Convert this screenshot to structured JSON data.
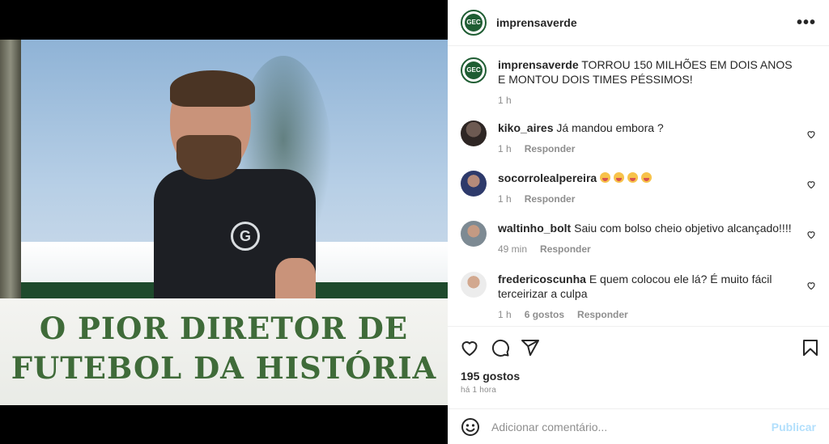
{
  "post": {
    "username": "imprensaverde",
    "more_label": "•••",
    "media": {
      "headline_line1": "O PIOR DIRETOR DE",
      "headline_line2": "FUTEBOL DA HISTÓRIA",
      "badge_letter": "G"
    },
    "caption": {
      "username": "imprensaverde",
      "text": "TORROU 150 MILHÕES EM DOIS ANOS E MONTOU DOIS TIMES PÉSSIMOS!",
      "time": "1 h"
    },
    "comments": [
      {
        "username": "kiko_aires",
        "text": "Já mandou embora ?",
        "time": "1 h",
        "likes": "",
        "reply_label": "Responder"
      },
      {
        "username": "socorrolealpereira",
        "text": "",
        "emoji_count": 4,
        "time": "1 h",
        "likes": "",
        "reply_label": "Responder"
      },
      {
        "username": "waltinho_bolt",
        "text": "Saiu com bolso cheio objetivo alcançado!!!!",
        "time": "49 min",
        "likes": "",
        "reply_label": "Responder"
      },
      {
        "username": "fredericoscunha",
        "text": "E quem colocou ele lá? É muito fácil terceirizar a culpa",
        "time": "1 h",
        "likes": "6 gostos",
        "reply_label": "Responder"
      }
    ],
    "likes_label": "195 gostos",
    "posted_time": "há 1 hora",
    "add_comment": {
      "placeholder": "Adicionar comentário...",
      "publish_label": "Publicar"
    }
  },
  "colors": {
    "headline_green": "#3f6b39",
    "brand_green": "#1f5d33",
    "publish_disabled": "#b2dffc",
    "meta_gray": "#8e8e8e"
  },
  "icons": {
    "like": "heart-icon",
    "comment": "comment-icon",
    "share": "share-icon",
    "save": "bookmark-icon",
    "emoji": "smiley-icon",
    "more": "more-options-icon"
  }
}
